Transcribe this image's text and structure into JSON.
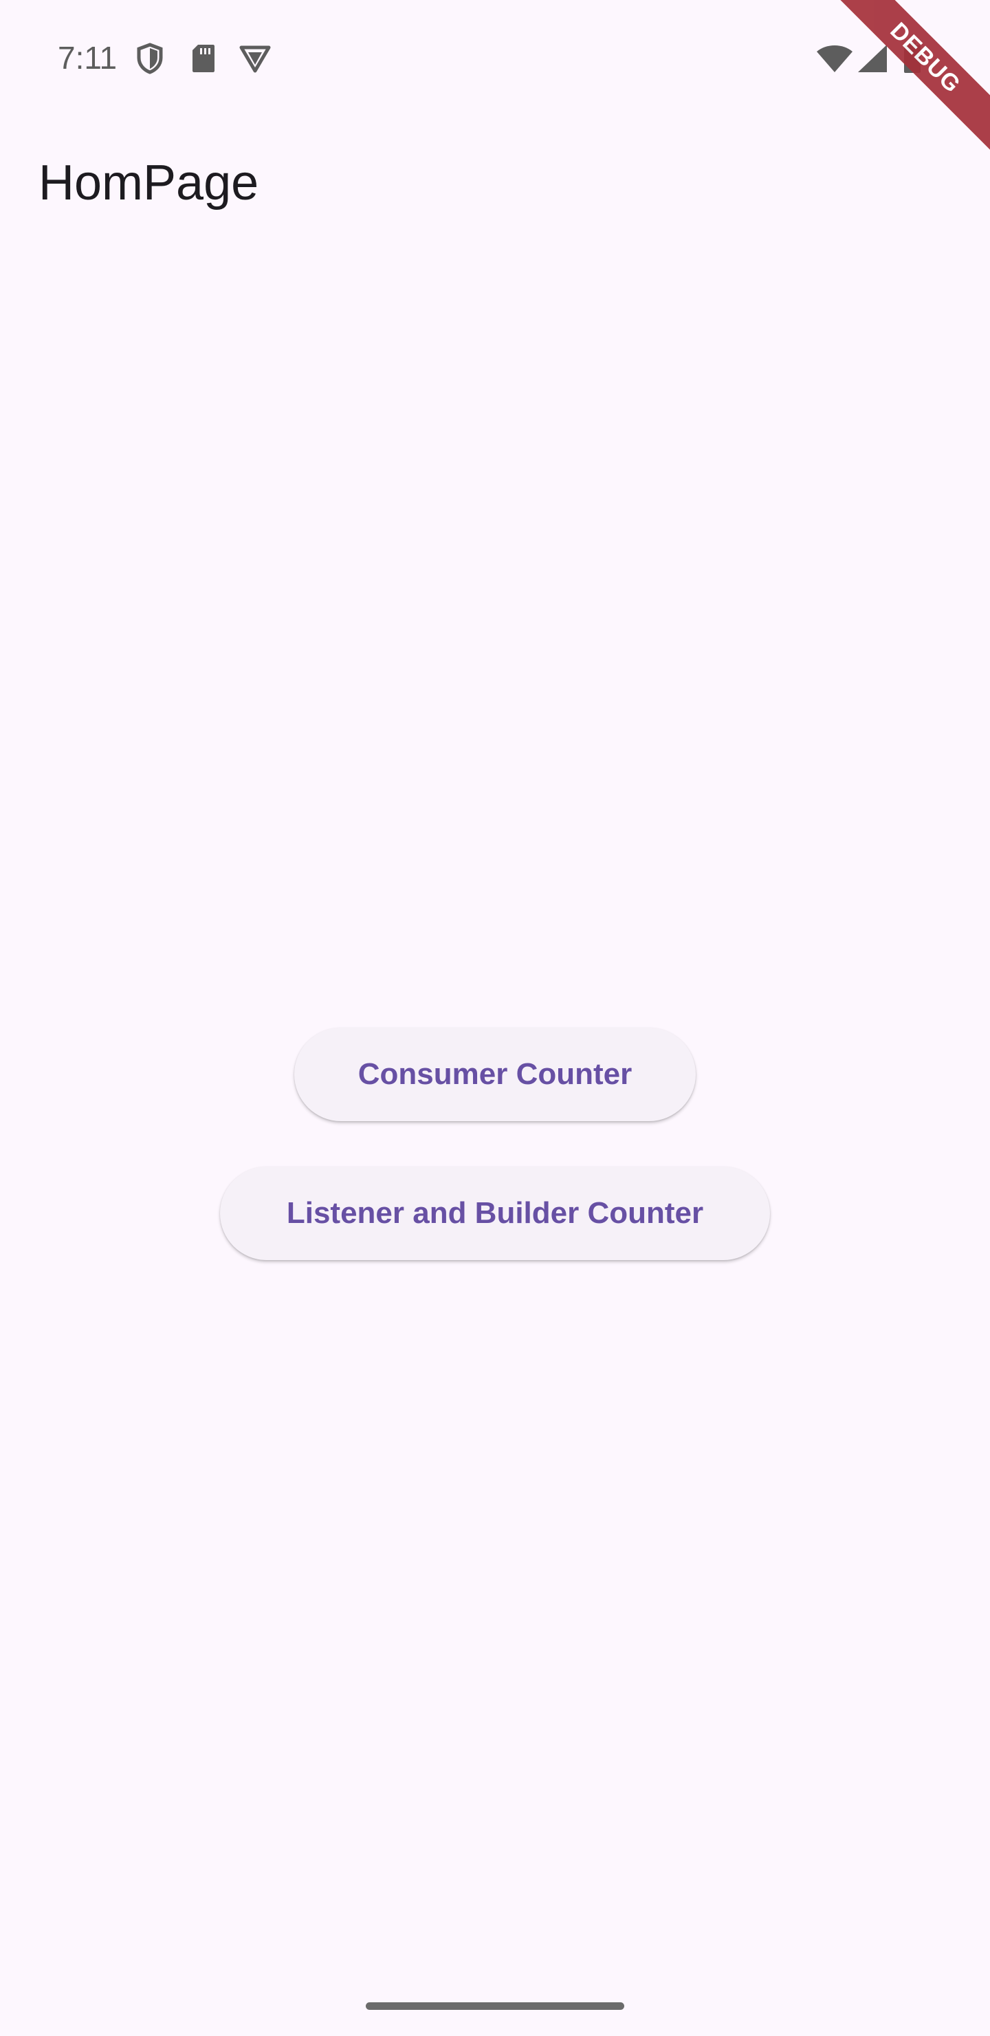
{
  "status_bar": {
    "time": "7:11",
    "icons": [
      "shield-icon",
      "sd-card-icon",
      "vpn-icon",
      "wifi-icon",
      "cellular-signal-icon",
      "battery-icon"
    ]
  },
  "app_bar": {
    "title": "HomPage"
  },
  "buttons": {
    "consumer_counter": "Consumer Counter",
    "listener_builder_counter": "Listener and Builder Counter"
  },
  "debug_banner": {
    "label": "DEBUG"
  },
  "colors": {
    "background": "#FDF7FE",
    "button_background": "#F6F1F8",
    "button_text": "#6750A4",
    "debug_banner": "#A5303A"
  }
}
